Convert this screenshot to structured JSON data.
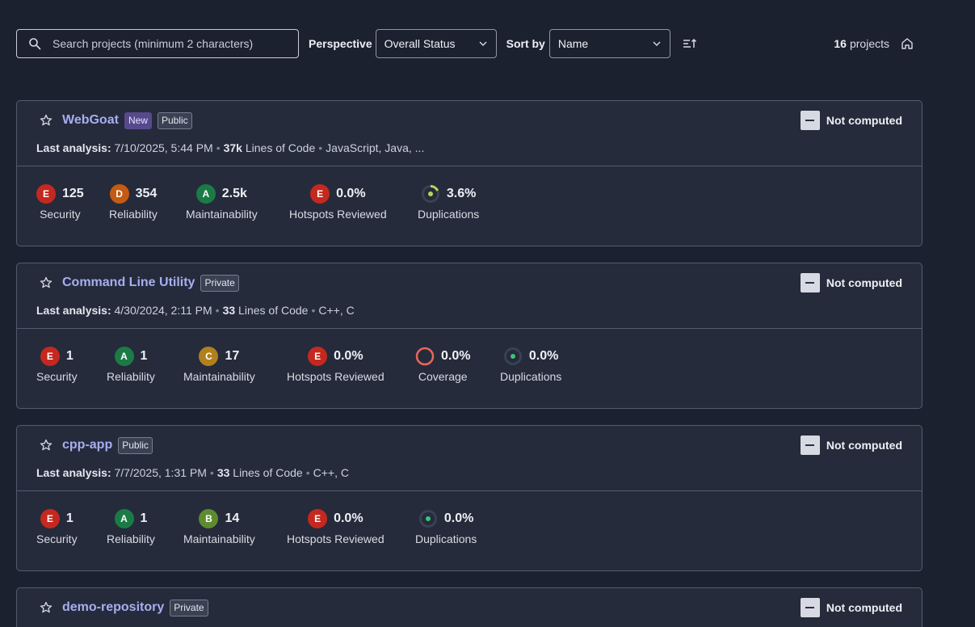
{
  "toolbar": {
    "search_placeholder": "Search projects (minimum 2 characters)",
    "perspective_label": "Perspective",
    "perspective_value": "Overall Status",
    "sort_label": "Sort by",
    "sort_value": "Name",
    "project_count": "16",
    "project_count_suffix": "projects"
  },
  "colors": {
    "background": "#1c2130",
    "card": "#252b3b",
    "project_link": "#a7aef0",
    "rating_A": "#1b7b45",
    "rating_B": "#5e8b2f",
    "rating_C": "#b27f1d",
    "rating_D": "#c55a12",
    "rating_E": "#c4281f"
  },
  "labels": {
    "last_analysis": "Last analysis:",
    "loc": "Lines of Code",
    "not_computed": "Not computed",
    "security": "Security",
    "reliability": "Reliability",
    "maintainability": "Maintainability",
    "hotspots": "Hotspots Reviewed",
    "coverage": "Coverage",
    "duplications": "Duplications"
  },
  "projects": [
    {
      "name": "WebGoat",
      "new_badge": "New",
      "visibility": "Public",
      "last_analysis": "7/10/2025, 5:44 PM",
      "loc": "37k",
      "languages": "JavaScript, Java, ...",
      "security": {
        "rating": "E",
        "value": "125"
      },
      "reliability": {
        "rating": "D",
        "value": "354"
      },
      "maintainability": {
        "rating": "A",
        "value": "2.5k"
      },
      "hotspots": {
        "rating": "E",
        "value": "0.0%"
      },
      "duplications": {
        "value": "3.6%"
      }
    },
    {
      "name": "Command Line Utility",
      "visibility": "Private",
      "last_analysis": "4/30/2024, 2:11 PM",
      "loc": "33",
      "languages": "C++, C",
      "security": {
        "rating": "E",
        "value": "1"
      },
      "reliability": {
        "rating": "A",
        "value": "1"
      },
      "maintainability": {
        "rating": "C",
        "value": "17"
      },
      "hotspots": {
        "rating": "E",
        "value": "0.0%"
      },
      "coverage": {
        "value": "0.0%"
      },
      "duplications": {
        "value": "0.0%"
      }
    },
    {
      "name": "cpp-app",
      "visibility": "Public",
      "last_analysis": "7/7/2025, 1:31 PM",
      "loc": "33",
      "languages": "C++, C",
      "security": {
        "rating": "E",
        "value": "1"
      },
      "reliability": {
        "rating": "A",
        "value": "1"
      },
      "maintainability": {
        "rating": "B",
        "value": "14"
      },
      "hotspots": {
        "rating": "E",
        "value": "0.0%"
      },
      "duplications": {
        "value": "0.0%"
      }
    },
    {
      "name": "demo-repository",
      "visibility": "Private"
    }
  ]
}
